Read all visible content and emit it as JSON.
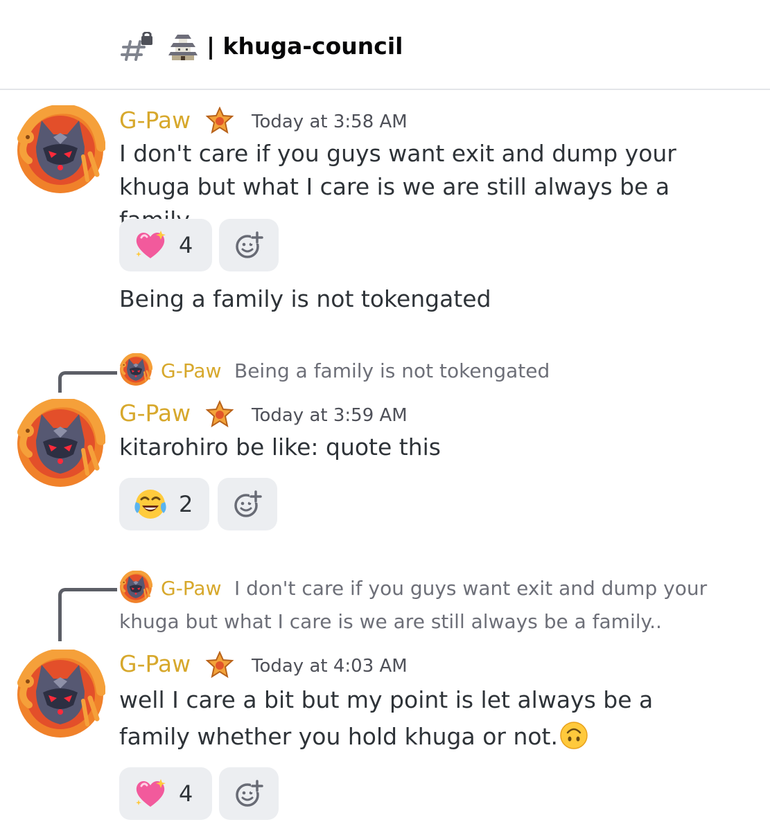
{
  "channel": {
    "name": "| khuga-council",
    "hash_icon": "locked-hash-icon",
    "emoji_icon": "japanese-castle-icon"
  },
  "colors": {
    "username": "#d7a82c",
    "text": "#2e3338",
    "muted": "#6d6f78",
    "reaction_bg": "#eceef1"
  },
  "messages": [
    {
      "author": "G-Paw",
      "role_icon": "orange-star-badge-icon",
      "timestamp": "Today at 3:58 AM",
      "text": "I don't care if you guys want exit and dump your khuga but what I care is we are still always be a family..",
      "reaction": {
        "emoji": "sparkling-heart-icon",
        "count": "4"
      },
      "followup": "Being a family is not tokengated"
    },
    {
      "reply": {
        "author": "G-Paw",
        "text": "Being a family is not tokengated"
      },
      "author": "G-Paw",
      "role_icon": "orange-star-badge-icon",
      "timestamp": "Today at 3:59 AM",
      "text": "kitarohiro be like: quote this",
      "reaction": {
        "emoji": "tears-of-joy-icon",
        "count": "2"
      }
    },
    {
      "reply": {
        "author": "G-Paw",
        "text": "I don't care if you guys want exit and dump your khuga but what I care is we are still always be a family.."
      },
      "author": "G-Paw",
      "role_icon": "orange-star-badge-icon",
      "timestamp": "Today at 4:03 AM",
      "text": "well I care a bit but my point is let always be a family whether you hold khuga or not.",
      "inline_emoji": "upside-down-face-icon",
      "reaction": {
        "emoji": "sparkling-heart-icon",
        "count": "4"
      }
    }
  ]
}
